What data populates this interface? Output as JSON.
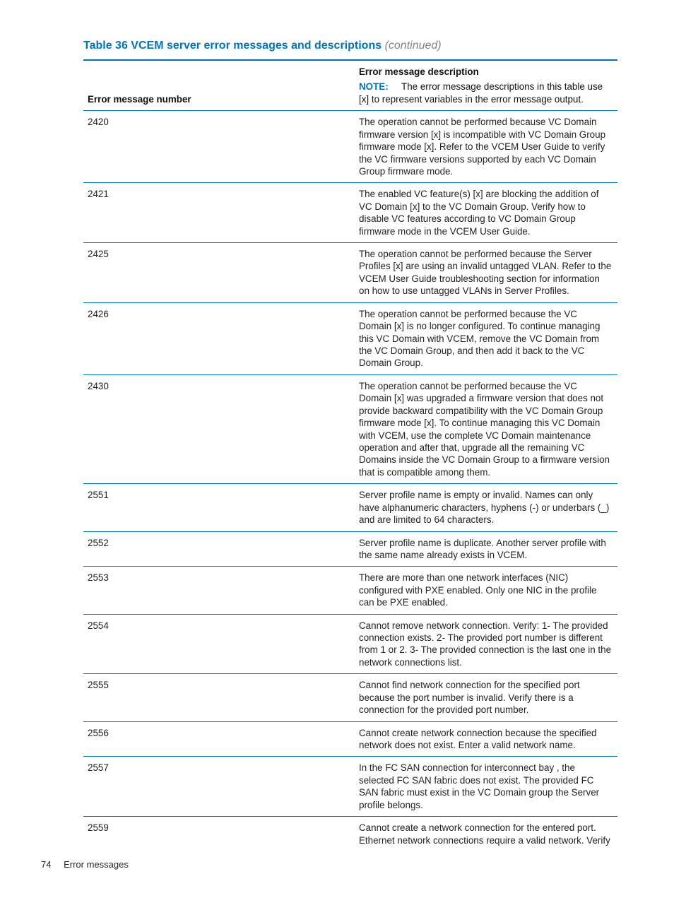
{
  "title": {
    "main": "Table 36 VCEM server error messages and descriptions",
    "continued": "(continued)"
  },
  "header": {
    "col_number": "Error message number",
    "col_description_heading": "Error message description",
    "note_label": "NOTE:",
    "note_text": "The error message descriptions in this table use [x] to represent variables in the error message output."
  },
  "rows": [
    {
      "num": "2420",
      "desc": "The operation cannot be performed because VC Domain firmware version [x] is incompatible with VC Domain Group firmware mode [x]. Refer to the VCEM User Guide to verify the VC firmware versions supported by each VC Domain Group firmware mode."
    },
    {
      "num": "2421",
      "desc": "The enabled VC feature(s) [x] are blocking the addition of VC Domain [x] to the VC Domain Group. Verify how to disable VC features according to VC Domain Group firmware mode in the VCEM User Guide."
    },
    {
      "num": "2425",
      "desc": "The operation cannot be performed because the Server Profiles [x] are using an invalid untagged VLAN. Refer to the VCEM User Guide troubleshooting section for information on how to use untagged VLANs in Server Profiles."
    },
    {
      "num": "2426",
      "desc": "The operation cannot be performed because the VC Domain [x] is no longer configured. To continue managing this VC Domain with VCEM, remove the VC Domain from the VC Domain Group, and then add it back to the VC Domain Group."
    },
    {
      "num": "2430",
      "desc": "The operation cannot be performed because the VC Domain [x] was upgraded a firmware version that does not provide backward compatibility with the VC Domain Group firmware mode [x]. To continue managing this VC Domain with VCEM, use the complete VC Domain maintenance operation and after that, upgrade all the remaining VC Domains inside the VC Domain Group to a firmware version that is compatible among them."
    },
    {
      "num": "2551",
      "desc": "Server profile name is empty or invalid. Names can only have alphanumeric characters, hyphens (-) or underbars (_) and are limited to 64 characters."
    },
    {
      "num": "2552",
      "desc": "Server profile name is duplicate. Another server profile with the same name already exists in VCEM."
    },
    {
      "num": "2553",
      "desc": "There are more than one network interfaces (NIC) configured with PXE enabled. Only one NIC in the profile can be PXE enabled."
    },
    {
      "num": "2554",
      "desc": "Cannot remove network connection. Verify: 1- The provided connection exists. 2- The provided port number is different from 1 or 2. 3- The provided connection is the last one in the network connections list."
    },
    {
      "num": "2555",
      "desc": "Cannot find network connection for the specified port because the port number is invalid. Verify there is a connection for the provided port number."
    },
    {
      "num": "2556",
      "desc": "Cannot create network connection because the specified network does not exist. Enter a valid network name."
    },
    {
      "num": "2557",
      "desc": "In the FC SAN connection for interconnect bay , the selected FC SAN fabric does not exist. The provided FC SAN fabric must exist in the VC Domain group the Server profile belongs."
    },
    {
      "num": "2559",
      "desc": "Cannot create a network connection for the entered port. Ethernet network connections require a valid network. Verify"
    }
  ],
  "footer": {
    "page_number": "74",
    "section": "Error messages"
  }
}
